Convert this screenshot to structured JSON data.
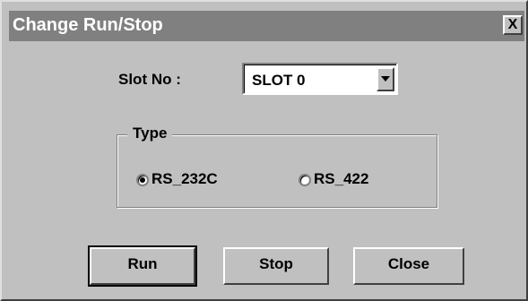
{
  "dialog": {
    "title": "Change Run/Stop",
    "close_label": "X"
  },
  "slot": {
    "label": "Slot No :",
    "selected": "SLOT 0"
  },
  "type_group": {
    "title": "Type",
    "options": [
      {
        "label": "RS_232C",
        "selected": true
      },
      {
        "label": "RS_422",
        "selected": false
      }
    ]
  },
  "buttons": {
    "run": "Run",
    "stop": "Stop",
    "close": "Close"
  },
  "colors": {
    "dialog_bg": "#c0c0c0",
    "titlebar_bg": "#808080",
    "title_text": "#ffffff"
  }
}
